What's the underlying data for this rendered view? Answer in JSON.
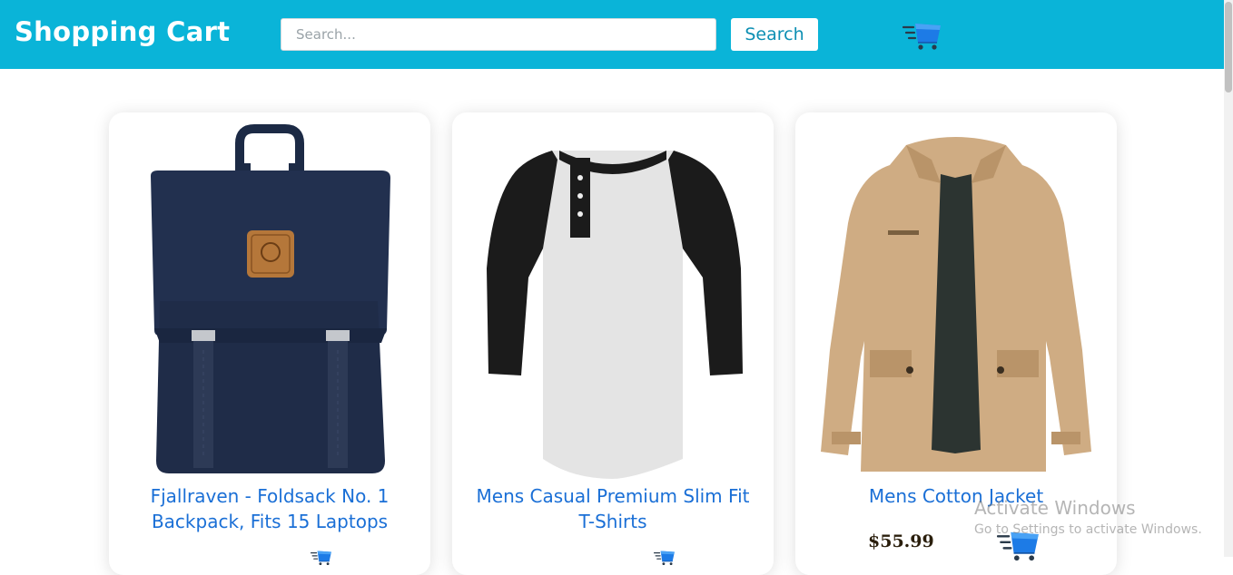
{
  "header": {
    "brand": "Shopping Cart",
    "search_placeholder": "Search...",
    "search_value": "",
    "search_button": "Search",
    "cart_icon": "cart-icon",
    "background_color": "#0ab4d8"
  },
  "products": [
    {
      "title": "Fjallraven - Foldsack No. 1 Backpack, Fits 15 Laptops",
      "image": "backpack-image",
      "price": ""
    },
    {
      "title": "Mens Casual Premium Slim Fit T-Shirts",
      "image": "tshirt-image",
      "price": ""
    },
    {
      "title": "Mens Cotton Jacket",
      "image": "jacket-image",
      "price": "$55.99"
    }
  ],
  "watermark": {
    "title": "Activate Windows",
    "subtitle": "Go to Settings to activate Windows."
  }
}
